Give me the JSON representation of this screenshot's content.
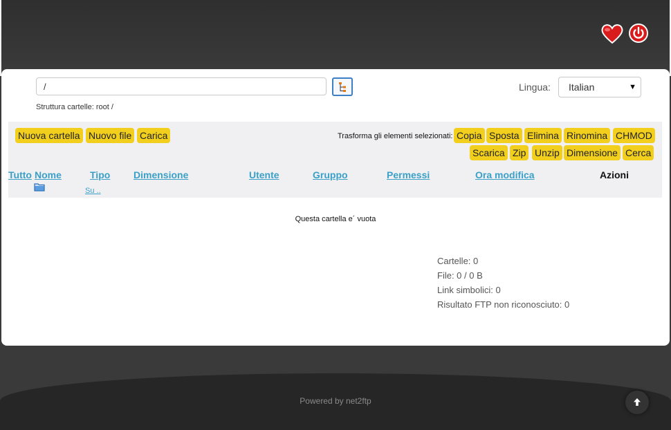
{
  "header": {
    "favorite_icon": "heart-icon",
    "logout_icon": "power-icon"
  },
  "browse": {
    "path_value": "/",
    "tree_icon": "folder-tree-icon",
    "structure_label": "Struttura cartelle: root /"
  },
  "language": {
    "label": "Lingua:",
    "selected": "Italian"
  },
  "actions": {
    "new_folder": "Nuova cartella",
    "new_file": "Nuovo file",
    "upload": "Carica",
    "transform_label": "Trasforma gli elementi selezionati:",
    "copy": "Copia",
    "move": "Sposta",
    "delete": "Elimina",
    "rename": "Rinomina",
    "chmod": "CHMOD",
    "download": "Scarica",
    "zip": "Zip",
    "unzip": "Unzip",
    "size": "Dimensione",
    "search": "Cerca"
  },
  "columns": {
    "all": "Tutto",
    "name": "Nome",
    "type": "Tipo",
    "size": "Dimensione",
    "user": "Utente",
    "group": "Gruppo",
    "perms": "Permessi",
    "mtime": "Ora modifica",
    "actions": "Azioni"
  },
  "listing": {
    "up_link": "Su ..",
    "empty_message": "Questa cartella e´ vuota"
  },
  "stats": {
    "folders": "Cartelle: 0",
    "files": "File: 0 / 0 B",
    "symlinks": "Link simbolici: 0",
    "unrecognized": "Risultato FTP non riconosciuto: 0"
  },
  "footer": {
    "powered_by": "Powered by net2ftp",
    "top_icon": "arrow-up-icon"
  },
  "colors": {
    "accent_yellow": "#f2cf1d",
    "link_blue": "#3aa0c8",
    "header_dark": "#333333"
  }
}
